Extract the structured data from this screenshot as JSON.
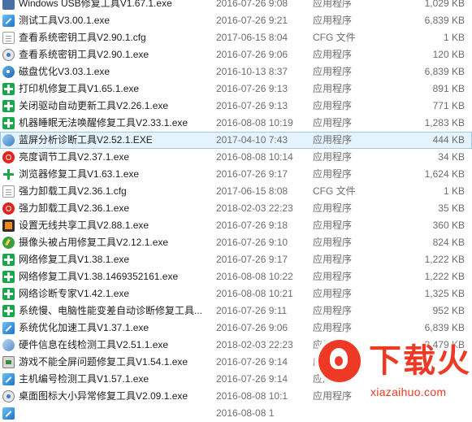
{
  "files": [
    {
      "name": "Windows USB修复工具V1.67.1.exe",
      "date": "2016-07-26 9:08",
      "type": "应用程序",
      "size": "1,029 KB",
      "icon": "usb-icon"
    },
    {
      "name": "测试工具V3.00.1.exe",
      "date": "2016-07-26 9:21",
      "type": "应用程序",
      "size": "6,839 KB",
      "icon": "blue-tool-icon"
    },
    {
      "name": "查看系统密钥工具V2.90.1.cfg",
      "date": "2017-06-15 8:04",
      "type": "CFG 文件",
      "size": "1 KB",
      "icon": "cfg-file-icon"
    },
    {
      "name": "查看系统密钥工具V2.90.1.exe",
      "date": "2016-07-26 9:06",
      "type": "应用程序",
      "size": "120 KB",
      "icon": "key-tool-icon"
    },
    {
      "name": "磁盘优化V3.03.1.exe",
      "date": "2016-10-13 8:37",
      "type": "应用程序",
      "size": "6,839 KB",
      "icon": "disk-icon"
    },
    {
      "name": "打印机修复工具V1.65.1.exe",
      "date": "2016-07-26 9:13",
      "type": "应用程序",
      "size": "891 KB",
      "icon": "green-plus-icon",
      "selected": true
    },
    {
      "name": "关闭驱动自动更新工具V2.26.1.exe",
      "date": "2016-07-26 9:13",
      "type": "应用程序",
      "size": "771 KB",
      "icon": "green-plus-icon"
    },
    {
      "name": "机器睡眠无法唤醒修复工具V2.33.1.exe",
      "date": "2016-08-08 10:19",
      "type": "应用程序",
      "size": "1,283 KB",
      "icon": "green-plus-icon"
    },
    {
      "name": "蓝屏分析诊断工具V2.52.1.EXE",
      "date": "2017-04-10 7:43",
      "type": "应用程序",
      "size": "444 KB",
      "icon": "wrench-icon",
      "highlighted": true
    },
    {
      "name": "亮度调节工具V2.37.1.exe",
      "date": "2016-08-08 10:14",
      "type": "应用程序",
      "size": "34 KB",
      "icon": "red-circle-icon"
    },
    {
      "name": "浏览器修复工具V1.63.1.exe",
      "date": "2016-07-26 9:17",
      "type": "应用程序",
      "size": "1,624 KB",
      "icon": "green-cross-icon"
    },
    {
      "name": "强力卸载工具V2.36.1.cfg",
      "date": "2017-06-15 8:08",
      "type": "CFG 文件",
      "size": "1 KB",
      "icon": "cfg-file-icon"
    },
    {
      "name": "强力卸载工具V2.36.1.exe",
      "date": "2018-02-03 22:23",
      "type": "应用程序",
      "size": "35 KB",
      "icon": "red-circle-icon"
    },
    {
      "name": "设置无线共享工具V2.88.1.exe",
      "date": "2016-07-26 9:18",
      "type": "应用程序",
      "size": "360 KB",
      "icon": "wifi-icon"
    },
    {
      "name": "摄像头被占用修复工具V2.12.1.exe",
      "date": "2016-07-26 9:10",
      "type": "应用程序",
      "size": "824 KB",
      "icon": "camera-icon"
    },
    {
      "name": "网络修复工具V1.38.1.exe",
      "date": "2016-07-26 9:17",
      "type": "应用程序",
      "size": "1,222 KB",
      "icon": "green-plus-icon"
    },
    {
      "name": "网络修复工具V1.38.1469352161.exe",
      "date": "2016-08-08 10:22",
      "type": "应用程序",
      "size": "1,222 KB",
      "icon": "green-plus-icon"
    },
    {
      "name": "网络诊断专家V1.42.1.exe",
      "date": "2016-08-08 10:21",
      "type": "应用程序",
      "size": "1,325 KB",
      "icon": "green-plus-icon"
    },
    {
      "name": "系统慢、电脑性能变差自动诊断修复工具...",
      "date": "2016-07-26 9:11",
      "type": "应用程序",
      "size": "952 KB",
      "icon": "green-plus-icon"
    },
    {
      "name": "系统优化加速工具V1.37.1.exe",
      "date": "2016-07-26 9:06",
      "type": "应用程序",
      "size": "6,839 KB",
      "icon": "blue-tool-icon"
    },
    {
      "name": "硬件信息在线检测工具V2.51.1.exe",
      "date": "2018-02-03 22:23",
      "type": "应用程序",
      "size": "3,479 KB",
      "icon": "hardware-icon"
    },
    {
      "name": "游戏不能全屏问题修复工具V1.54.1.exe",
      "date": "2016-07-26 9:14",
      "type": "应用程序",
      "size": "",
      "icon": "game-icon"
    },
    {
      "name": "主机编号检测工具V1.57.1.exe",
      "date": "2016-07-26 9:14",
      "type": "应用程序",
      "size": "",
      "icon": "blue-tool-icon"
    },
    {
      "name": "桌面图标大小异常修复工具V2.09.1.exe",
      "date": "2016-08-08 10:1",
      "type": "应用程序",
      "size": "",
      "icon": "gear-icon"
    },
    {
      "name": "",
      "date": "2016-08-08 1",
      "type": "",
      "size": "",
      "icon": "blue-tool-icon"
    }
  ],
  "watermark": {
    "title": "下载火",
    "url": "xiazaihuo.com"
  },
  "colors": {
    "watermark": "#ee3a24",
    "selection_border": "#99c9ef",
    "selection_fill": "#e5f3ff",
    "secondary_text": "#6d6d6d"
  }
}
